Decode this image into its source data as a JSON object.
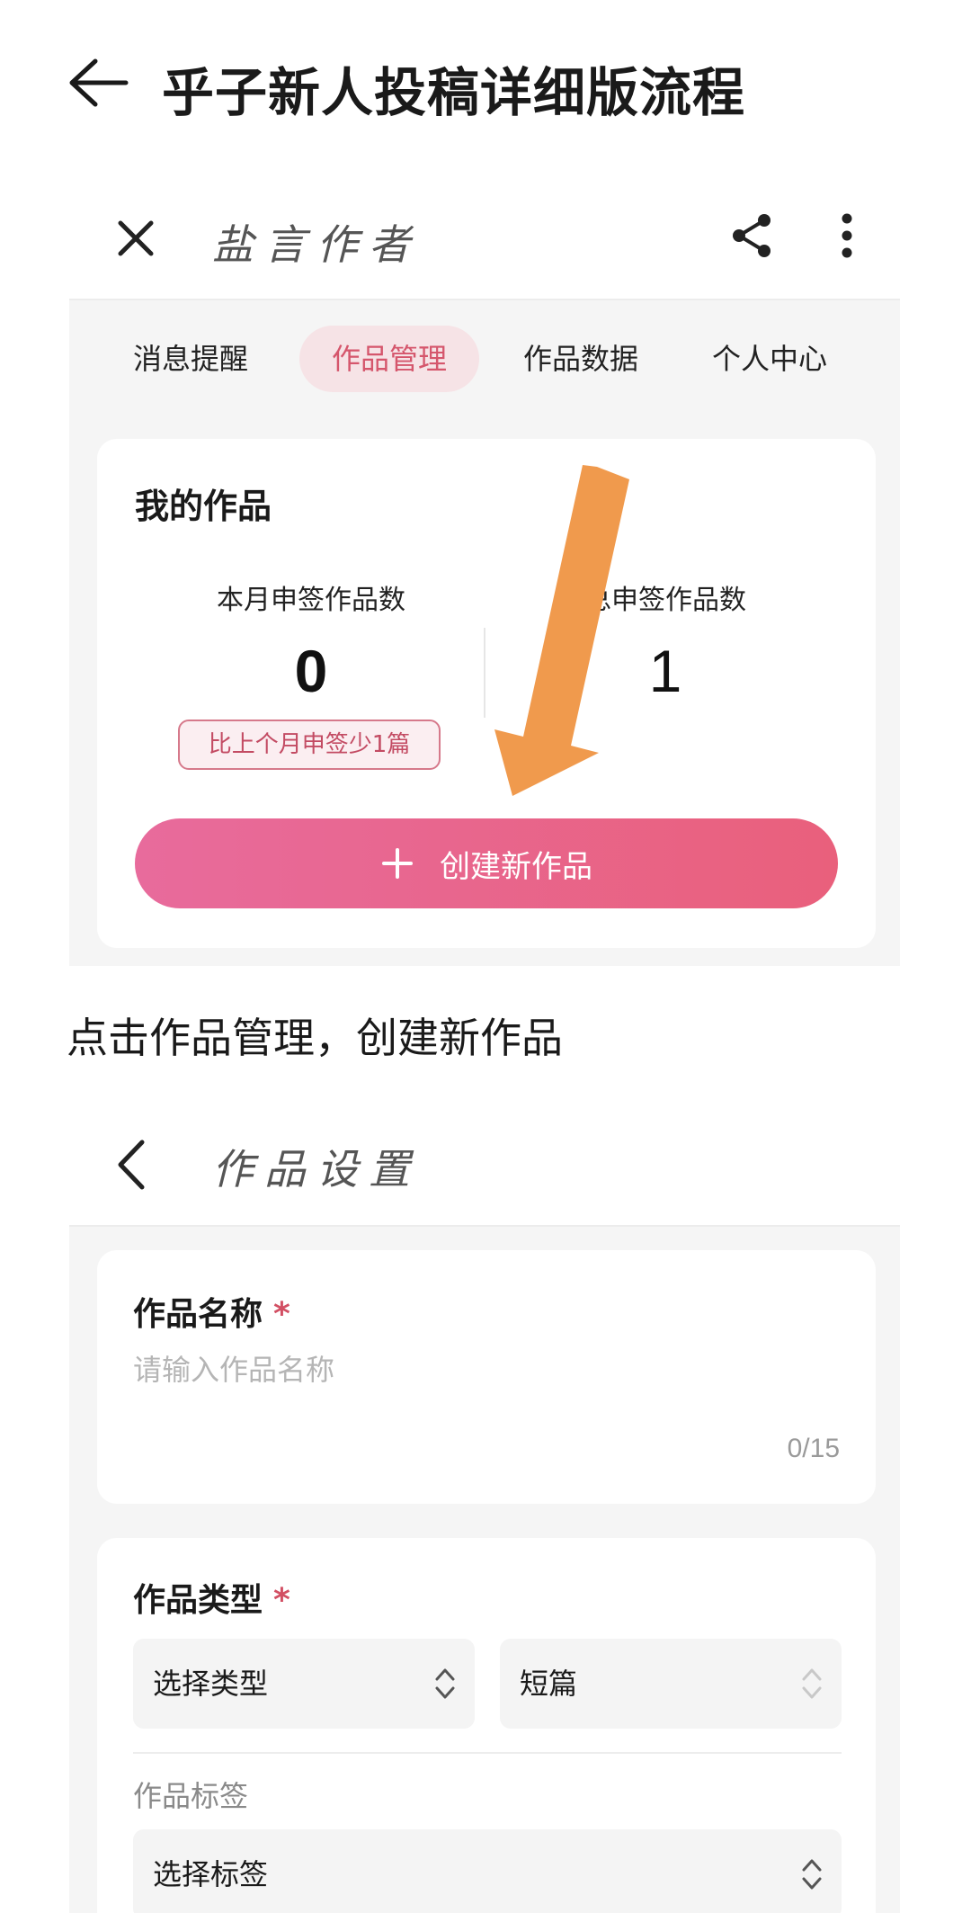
{
  "post": {
    "title": "乎子新人投稿详细版流程",
    "back_icon": "arrow-left-icon",
    "caption": "点击作品管理，创建新作品"
  },
  "screen1": {
    "bar_title": "盐言作者",
    "tabs": [
      {
        "label": "消息提醒",
        "active": false
      },
      {
        "label": "作品管理",
        "active": true
      },
      {
        "label": "作品数据",
        "active": false
      },
      {
        "label": "个人中心",
        "active": false
      }
    ],
    "card": {
      "title": "我的作品",
      "left_stat_label": "本月申签作品数",
      "left_stat_value": "0",
      "right_stat_label": "总申签作品数",
      "right_stat_value": "1",
      "compare_badge": "比上个月申签少1篇",
      "create_button": "创建新作品"
    },
    "colors": {
      "accent": "#e9607c",
      "tab_active_bg": "#f6e3e6",
      "annotation_arrow": "#f09a4d"
    }
  },
  "screen2": {
    "bar_title": "作品设置",
    "name_field": {
      "label": "作品名称",
      "required_mark": "*",
      "placeholder": "请输入作品名称",
      "value": "",
      "count": "0/15"
    },
    "type_field": {
      "label": "作品类型",
      "required_mark": "*",
      "type_select": "选择类型",
      "length_select": "短篇"
    },
    "tags_field": {
      "label": "作品标签",
      "select": "选择标签"
    }
  }
}
